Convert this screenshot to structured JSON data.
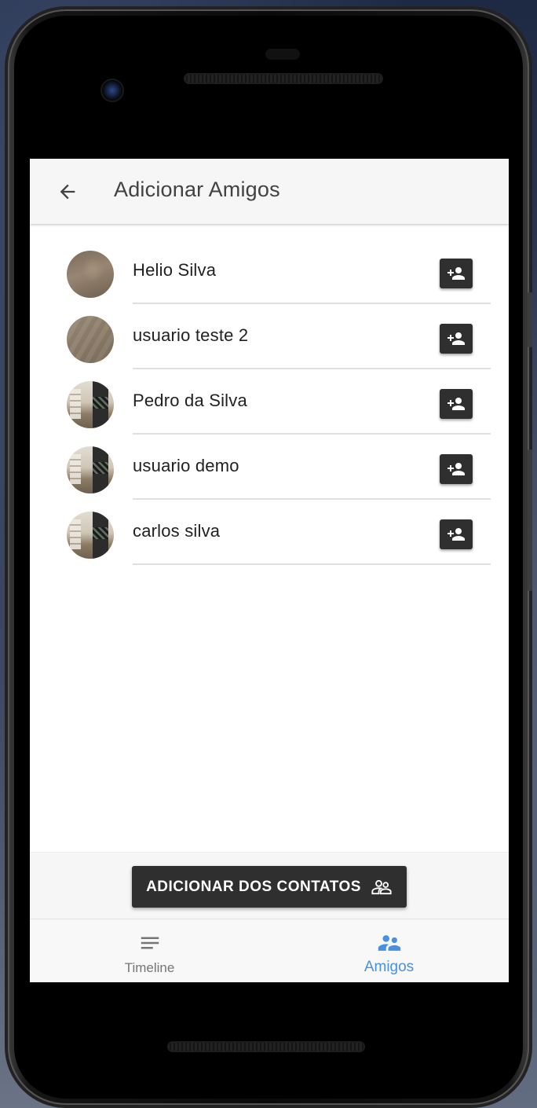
{
  "app_bar": {
    "title": "Adicionar Amigos",
    "back_icon": "arrow-back-icon"
  },
  "friends": [
    {
      "name": "Helio Silva",
      "action_icon": "person-add-icon"
    },
    {
      "name": "usuario teste 2",
      "action_icon": "person-add-icon"
    },
    {
      "name": "Pedro da Silva",
      "action_icon": "person-add-icon"
    },
    {
      "name": "usuario demo",
      "action_icon": "person-add-icon"
    },
    {
      "name": "carlos silva",
      "action_icon": "person-add-icon"
    }
  ],
  "contacts_button": {
    "label": "ADICIONAR DOS CONTATOS",
    "icon": "supervisor-account-icon"
  },
  "bottom_nav": {
    "items": [
      {
        "label": "Timeline",
        "icon": "notes-icon",
        "active": false
      },
      {
        "label": "Amigos",
        "icon": "people-icon",
        "active": true
      }
    ]
  },
  "colors": {
    "accent": "#4a90e2",
    "dark_button": "#2f2f2f",
    "app_bar_bg": "#f6f6f6"
  }
}
